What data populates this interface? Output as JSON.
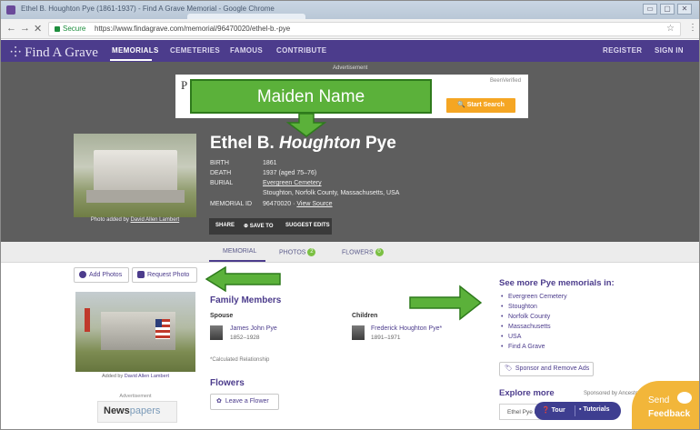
{
  "window": {
    "title": "Ethel B. Houghton Pye (1861-1937) - Find A Grave Memorial - Google Chrome",
    "controls": [
      "▭",
      "▢",
      "✕"
    ]
  },
  "browser": {
    "back": "←",
    "forward": "→",
    "reload": "✕",
    "secure_label": "Secure",
    "url": "https://www.findagrave.com/memorial/96470020/ethel-b.-pye",
    "star": "☆",
    "menu": "⋮"
  },
  "site_nav": {
    "logo": "Find A Grave",
    "items": [
      "MEMORIALS",
      "CEMETERIES",
      "FAMOUS",
      "CONTRIBUTE"
    ],
    "register": "REGISTER",
    "sign_in": "SIGN IN"
  },
  "advertisement": {
    "label": "Advertisement",
    "letter": "P",
    "brand": "BeenVerified",
    "button": "Start Search"
  },
  "annotations": {
    "maiden": "Maiden Name",
    "color": "#5bb13a",
    "border": "#2e7a1c"
  },
  "memorial": {
    "name_first": "Ethel B.",
    "name_maiden": "Houghton",
    "name_last": "Pye",
    "photo_caption_prefix": "Photo added by",
    "photo_caption_author": "David Allen Lambert",
    "facts": {
      "birth_label": "BIRTH",
      "birth_value": "1861",
      "death_label": "DEATH",
      "death_value": "1937 (aged 75–76)",
      "burial_label": "BURIAL",
      "burial_cemetery": "Evergreen Cemetery",
      "burial_location": "Stoughton, Norfolk County, Massachusetts, USA",
      "id_label": "MEMORIAL ID",
      "id_value": "96470020",
      "id_link": "View Source"
    },
    "actions": {
      "share": "SHARE",
      "save_to": "SAVE TO",
      "suggest": "SUGGEST EDITS"
    }
  },
  "tabs": {
    "memorial": "MEMORIAL",
    "photos": "PHOTOS",
    "photos_count": "2",
    "flowers": "FLOWERS",
    "flowers_count": "0"
  },
  "left": {
    "add_photos": "Add Photos",
    "request_photo": "Request Photo",
    "added_by_prefix": "Added by",
    "added_by": "David Allen Lambert",
    "advertisement": "Advertisement",
    "newspapers_a": "News",
    "newspapers_b": "papers"
  },
  "family": {
    "title": "Family Members",
    "spouse_label": "Spouse",
    "spouse_name": "James John Pye",
    "spouse_dates": "1852–1928",
    "children_label": "Children",
    "child_name": "Frederick Houghton Pye*",
    "child_dates": "1891–1971",
    "calc_note": "*Calculated Relationship"
  },
  "flowers": {
    "title": "Flowers",
    "button": "Leave a Flower"
  },
  "see_more": {
    "title": "See more Pye memorials in:",
    "items": [
      "Evergreen Cemetery",
      "Stoughton",
      "Norfolk County",
      "Massachusetts",
      "USA",
      "Find A Grave"
    ],
    "sponsor_button": "Sponsor and Remove Ads"
  },
  "explore": {
    "title": "Explore more",
    "sponsor": "Sponsored by Ancestry",
    "input_value": "Ethel Pye in"
  },
  "overlay": {
    "tour": "Tour",
    "tutorials": "Tutorials",
    "feedback_send": "Send",
    "feedback_label": "Feedback"
  }
}
